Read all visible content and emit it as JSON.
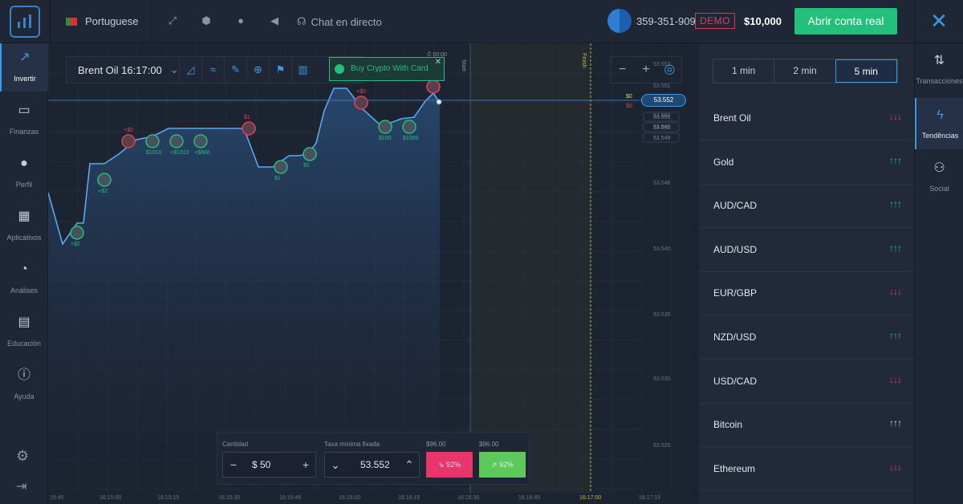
{
  "header": {
    "language": "Portuguese",
    "chat_label": "Chat en directo",
    "account_id": "359-351-909",
    "demo_label": "DEMO",
    "balance": "$10,000",
    "open_real_label": "Abrir conta real"
  },
  "left_nav": {
    "items": [
      {
        "label": "Invertir",
        "icon": "trending-up-icon"
      },
      {
        "label": "Finanzas",
        "icon": "wallet-icon"
      },
      {
        "label": "Perfil",
        "icon": "user-icon"
      },
      {
        "label": "Aplicativos",
        "icon": "grid-icon"
      },
      {
        "label": "Análises",
        "icon": "pie-chart-icon"
      },
      {
        "label": "Educación",
        "icon": "book-icon"
      },
      {
        "label": "Ayuda",
        "icon": "info-icon"
      }
    ]
  },
  "chart": {
    "asset": "Brent Oil 16:17:00",
    "promo_label": "Buy Crypto With Card",
    "current_price": "53.552",
    "timer": "00:00",
    "start_label": "Start",
    "finish_label": "Finish",
    "accent": "#3a9be0"
  },
  "chart_data": {
    "type": "line",
    "x": [
      "16:15:45",
      "16:15:50",
      "16:15:55",
      "16:16:00",
      "16:16:05",
      "16:16:10",
      "16:16:15",
      "16:16:20",
      "16:16:25",
      "16:16:30",
      "16:16:35",
      "16:16:40",
      "16:16:45",
      "16:16:50",
      "16:16:55",
      "16:17:00",
      "16:17:05",
      "16:17:10"
    ],
    "x_ticks": [
      "15:45",
      "16:15:00",
      "16:15:15",
      "16:15:30",
      "16:15:45",
      "16:16:00",
      "16:16:15",
      "16:16:30",
      "16:16:45",
      "16:17:00",
      "16:17:15"
    ],
    "y_ticks": [
      "53.553",
      "53.551",
      "53.550",
      "53.549",
      "53.546",
      "53.540",
      "53.535",
      "53.530",
      "53.525"
    ],
    "ylim": [
      53.522,
      53.556
    ],
    "labels_price": [
      "53.552",
      "53.551",
      "53.550",
      "53.549"
    ],
    "pnl_labels_green": [
      "$0"
    ],
    "pnl_labels_red": [
      "$0"
    ],
    "trade_labels": [
      "+$2",
      "+$2",
      "$1010",
      "+$1010",
      "+$666",
      "$1",
      "$1",
      "$100",
      "$1000"
    ],
    "trade_labels_red": [
      "+$0",
      "$1",
      "+$0"
    ]
  },
  "trade_panel": {
    "amount_label": "Cantidad",
    "amount_value": "$ 50",
    "rate_label": "Taxa mínima fixada",
    "rate_value": "53.552",
    "payout_down": "$96.00",
    "payout_up": "$96.00",
    "down_pct": "92%",
    "up_pct": "92%"
  },
  "trends": {
    "timeframes": [
      "1 min",
      "2 min",
      "5 min"
    ],
    "active_timeframe": "5 min",
    "assets": [
      {
        "name": "Brent Oil",
        "trend": "down",
        "arrows": "↓↓↓"
      },
      {
        "name": "Gold",
        "trend": "up",
        "arrows": "↑↑↑"
      },
      {
        "name": "AUD/CAD",
        "trend": "up",
        "arrows": "↑↑↑"
      },
      {
        "name": "AUD/USD",
        "trend": "up",
        "arrows": "↑↑↑"
      },
      {
        "name": "EUR/GBP",
        "trend": "down",
        "arrows": "↓↓↓"
      },
      {
        "name": "NZD/USD",
        "trend": "up",
        "arrows": "↑↑↑"
      },
      {
        "name": "USD/CAD",
        "trend": "down",
        "arrows": "↓↓↓"
      },
      {
        "name": "Bitcoin",
        "trend": "neutral",
        "arrows": "↑↑↑"
      },
      {
        "name": "Ethereum",
        "trend": "down",
        "arrows": "↓↓↓"
      }
    ],
    "colors": {
      "up": "#22c07a",
      "down": "#e0405a",
      "neutral": "#c7cdd8"
    }
  },
  "right_nav": {
    "items": [
      {
        "label": "Transacciones",
        "icon": "swap-vertical-icon"
      },
      {
        "label": "Tendências",
        "icon": "lightning-icon"
      },
      {
        "label": "Social",
        "icon": "user-plus-icon"
      }
    ]
  }
}
